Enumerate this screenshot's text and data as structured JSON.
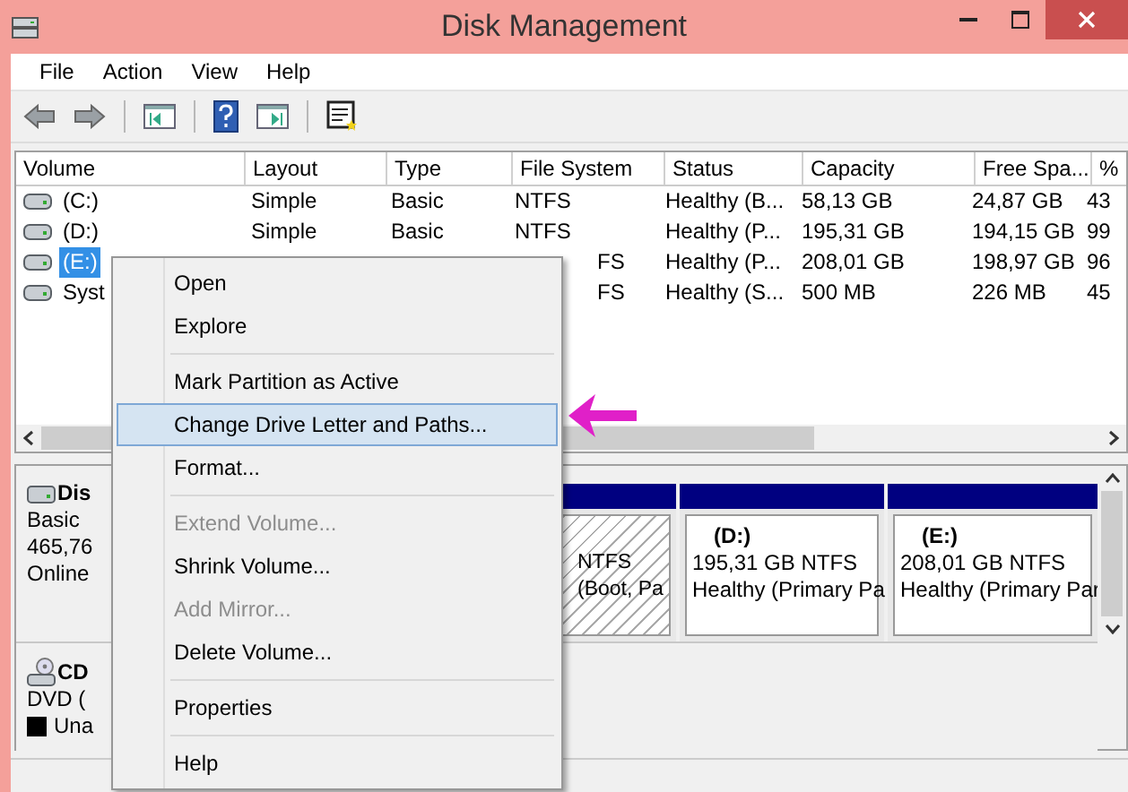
{
  "window": {
    "title": "Disk Management"
  },
  "menu_bar": [
    "File",
    "Action",
    "View",
    "Help"
  ],
  "toolbar": [
    {
      "kind": "back"
    },
    {
      "kind": "forward"
    },
    {
      "kind": "sep"
    },
    {
      "kind": "tree"
    },
    {
      "kind": "sep"
    },
    {
      "kind": "help"
    },
    {
      "kind": "pane"
    },
    {
      "kind": "sep"
    },
    {
      "kind": "sheet"
    }
  ],
  "table": {
    "columns": [
      "Volume",
      "Layout",
      "Type",
      "File System",
      "Status",
      "Capacity",
      "Free Spa...",
      "%"
    ],
    "rows": [
      {
        "volume": "(C:)",
        "layout": "Simple",
        "type": "Basic",
        "file_system": "NTFS",
        "status": "Healthy (B...",
        "capacity": "58,13 GB",
        "free_space": "24,87 GB",
        "percent_free": "43",
        "selected": false
      },
      {
        "volume": "(D:)",
        "layout": "Simple",
        "type": "Basic",
        "file_system": "NTFS",
        "status": "Healthy (P...",
        "capacity": "195,31 GB",
        "free_space": "194,15 GB",
        "percent_free": "99",
        "selected": false
      },
      {
        "volume": "(E:)",
        "file_system": "FS",
        "status": "Healthy (P...",
        "capacity": "208,01 GB",
        "free_space": "198,97 GB",
        "percent_free": "96",
        "selected": true
      },
      {
        "volume": "Syst",
        "file_system": "FS",
        "status": "Healthy (S...",
        "capacity": "500 MB",
        "free_space": "226 MB",
        "percent_free": "45",
        "selected": false
      }
    ]
  },
  "disks": [
    {
      "kind": "hdd",
      "name": "Dis",
      "lines": [
        "Basic",
        "465,76",
        "Online"
      ],
      "partitions": [
        {
          "lines": [
            "NTFS",
            "(Boot, Pa"
          ],
          "selected": true
        },
        {
          "name": "(D:)",
          "lines": [
            "195,31 GB NTFS",
            "Healthy (Primary Pa"
          ],
          "selected": false
        },
        {
          "name": "(E:)",
          "lines": [
            "208,01 GB NTFS",
            "Healthy (Primary Par"
          ],
          "selected": false
        }
      ]
    },
    {
      "kind": "cd",
      "name": "CD",
      "lines": [
        "DVD ("
      ],
      "legend": "Una"
    }
  ],
  "context_menu": [
    [
      {
        "label": "Open",
        "disabled": false,
        "selected": false
      },
      {
        "label": "Explore",
        "disabled": false,
        "selected": false
      }
    ],
    [
      {
        "label": "Mark Partition as Active",
        "disabled": false,
        "selected": false
      },
      {
        "label": "Change Drive Letter and Paths...",
        "disabled": false,
        "selected": true
      },
      {
        "label": "Format...",
        "disabled": false,
        "selected": false
      }
    ],
    [
      {
        "label": "Extend Volume...",
        "disabled": true,
        "selected": false
      },
      {
        "label": "Shrink Volume...",
        "disabled": false,
        "selected": false
      },
      {
        "label": "Add Mirror...",
        "disabled": true,
        "selected": false
      },
      {
        "label": "Delete Volume...",
        "disabled": false,
        "selected": false
      }
    ],
    [
      {
        "label": "Properties",
        "disabled": false,
        "selected": false
      }
    ],
    [
      {
        "label": "Help",
        "disabled": false,
        "selected": false
      }
    ]
  ]
}
